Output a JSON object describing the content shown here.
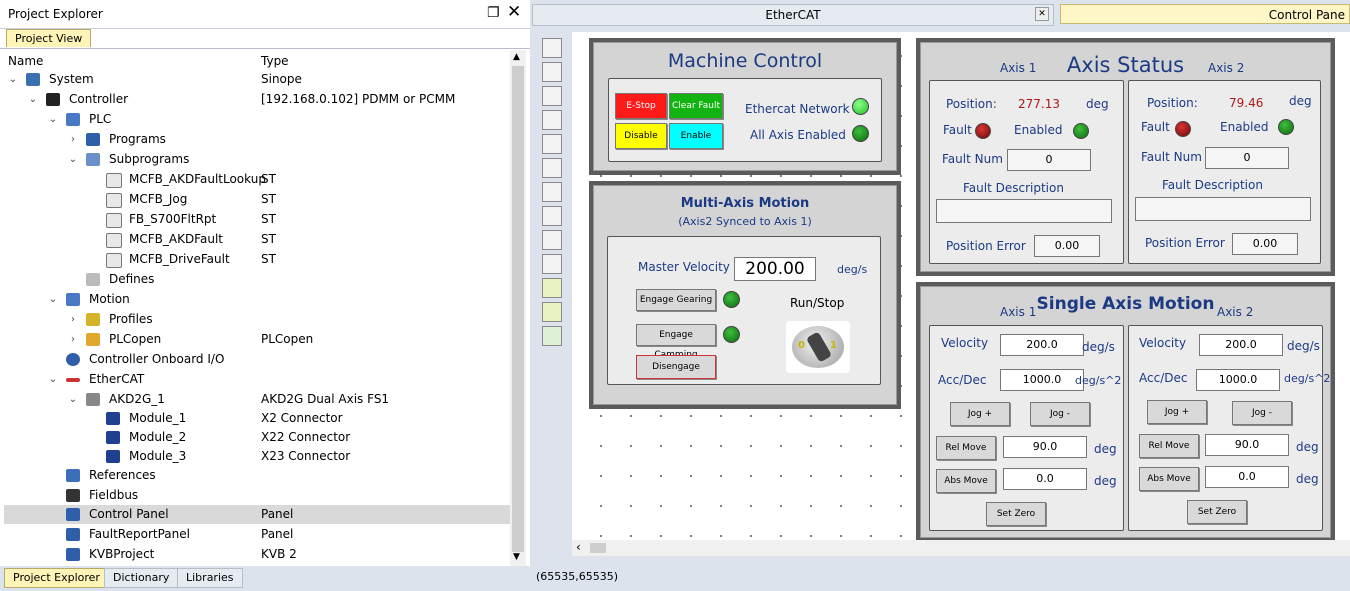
{
  "explorer": {
    "title": "Project Explorer",
    "view_tab": "Project View",
    "col_name": "Name",
    "col_type": "Type",
    "rows": [
      {
        "label": "System",
        "type": "Sinope"
      },
      {
        "label": "Controller",
        "type": "[192.168.0.102] PDMM or PCMM"
      },
      {
        "label": "PLC",
        "type": ""
      },
      {
        "label": "Programs",
        "type": ""
      },
      {
        "label": "Subprograms",
        "type": ""
      },
      {
        "label": "MCFB_AKDFaultLookup",
        "type": "ST"
      },
      {
        "label": "MCFB_Jog",
        "type": "ST"
      },
      {
        "label": "FB_S700FltRpt",
        "type": "ST"
      },
      {
        "label": "MCFB_AKDFault",
        "type": "ST"
      },
      {
        "label": "MCFB_DriveFault",
        "type": "ST"
      },
      {
        "label": "Defines",
        "type": ""
      },
      {
        "label": "Motion",
        "type": ""
      },
      {
        "label": "Profiles",
        "type": ""
      },
      {
        "label": "PLCopen",
        "type": "PLCopen"
      },
      {
        "label": "Controller Onboard I/O",
        "type": ""
      },
      {
        "label": "EtherCAT",
        "type": ""
      },
      {
        "label": "AKD2G_1",
        "type": "AKD2G Dual Axis FS1"
      },
      {
        "label": "Module_1",
        "type": "X2 Connector"
      },
      {
        "label": "Module_2",
        "type": "X22 Connector"
      },
      {
        "label": "Module_3",
        "type": "X23 Connector"
      },
      {
        "label": "References",
        "type": ""
      },
      {
        "label": "Fieldbus",
        "type": ""
      },
      {
        "label": "Control Panel",
        "type": "Panel"
      },
      {
        "label": "FaultReportPanel",
        "type": "Panel"
      },
      {
        "label": "KVBProject",
        "type": "KVB 2"
      }
    ],
    "bottom_tabs": [
      "Project Explorer",
      "Dictionary",
      "Libraries"
    ]
  },
  "docs": {
    "tab1": "EtherCAT",
    "tab2": "Control Pane"
  },
  "status": "(65535,65535)",
  "machine": {
    "title": "Machine Control",
    "estop": "E-Stop",
    "clear": "Clear Fault",
    "disable": "Disable",
    "enable": "Enable",
    "net": "Ethercat Network",
    "all": "All Axis Enabled"
  },
  "multi": {
    "title": "Multi-Axis Motion",
    "sub": "(Axis2 Synced to Axis 1)",
    "mv_label": "Master Velocity",
    "mv_value": "200.00",
    "mv_unit": "deg/s",
    "gear": "Engage Gearing",
    "cam": "Engage Camming",
    "dis": "Disengage",
    "runstop": "Run/Stop",
    "sw0": "0",
    "sw1": "1"
  },
  "axis_status": {
    "title": "Axis Status",
    "a1": "Axis 1",
    "a2": "Axis 2",
    "pos_label": "Position:",
    "deg": "deg",
    "fault": "Fault",
    "enabled": "Enabled",
    "fnum": "Fault Num",
    "fdesc": "Fault Description",
    "perr": "Position Error",
    "axis1": {
      "pos": "277.13",
      "fnum": "0",
      "fdesc": "",
      "perr": "0.00"
    },
    "axis2": {
      "pos": "79.46",
      "fnum": "0",
      "fdesc": "",
      "perr": "0.00"
    }
  },
  "single": {
    "title": "Single Axis Motion",
    "a1": "Axis 1",
    "a2": "Axis 2",
    "vel": "Velocity",
    "acc": "Acc/Dec",
    "degs": "deg/s",
    "degs2": "deg/s^2",
    "deg": "deg",
    "jogp": "Jog +",
    "jogm": "Jog -",
    "rel": "Rel Move",
    "abs": "Abs Move",
    "zero": "Set Zero",
    "axis1": {
      "vel": "200.0",
      "acc": "1000.0",
      "rel": "90.0",
      "abs": "0.0"
    },
    "axis2": {
      "vel": "200.0",
      "acc": "1000.0",
      "rel": "90.0",
      "abs": "0.0"
    }
  }
}
